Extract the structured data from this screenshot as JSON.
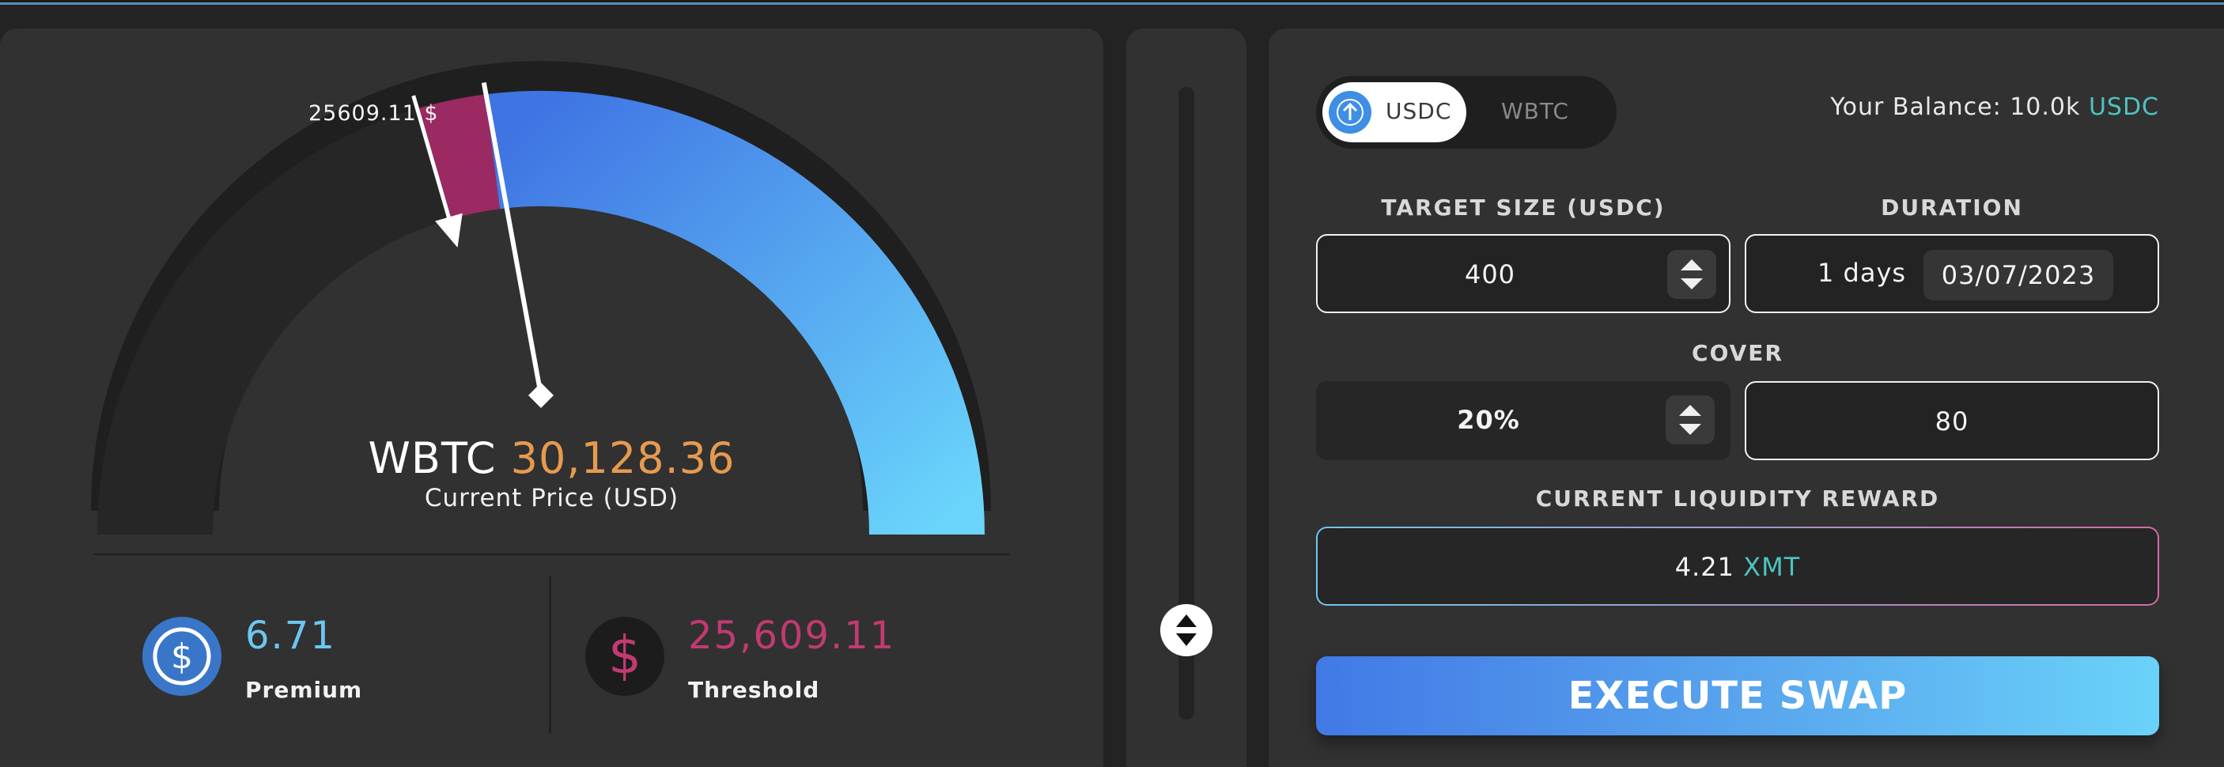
{
  "gauge": {
    "asset": "WBTC",
    "current_price": "30,128.36",
    "current_price_label": "Current Price (USD)",
    "threshold_tag": "25609.11 $",
    "current_price_fraction": 0.46,
    "threshold_fraction": 0.41
  },
  "stats": {
    "premium": {
      "value": "6.71",
      "label": "Premium",
      "icon": "usdc-coin-icon"
    },
    "threshold": {
      "value": "25,609.11",
      "label": "Threshold",
      "icon": "dollar-icon"
    }
  },
  "swap": {
    "toggle": {
      "selected": "USDC",
      "other": "WBTC"
    },
    "balance": {
      "label": "Your Balance: 10.0k",
      "currency": "USDC"
    },
    "target_size": {
      "label": "TARGET SIZE (USDC)",
      "value": "400"
    },
    "duration": {
      "label": "DURATION",
      "days": "1 days",
      "date": "03/07/2023"
    },
    "cover": {
      "label": "COVER",
      "percent": "20%",
      "amount": "80"
    },
    "reward": {
      "label": "CURRENT LIQUIDITY REWARD",
      "value": "4.21",
      "unit": "XMT"
    },
    "execute_label": "EXECUTE SWAP"
  },
  "colors": {
    "accent_blue": "#4179e6",
    "accent_cyan": "#6ad2f9",
    "threshold_pink": "#c23a72",
    "price_orange": "#e69a4f",
    "token_teal": "#4ec3c0"
  }
}
